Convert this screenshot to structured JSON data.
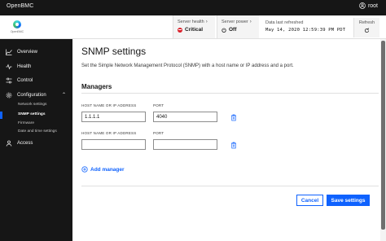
{
  "header": {
    "app_title": "OpenBMC",
    "user": "root",
    "user_icon": "user-avatar-icon"
  },
  "status": {
    "logo_text": "OpenBMC",
    "health_label": "Server health",
    "health_value": "Critical",
    "health_color": "#da1e28",
    "power_label": "Server power",
    "power_value": "Off",
    "refresh_label": "Data last refreshed",
    "refresh_date": "May 14, 2020 12:59:39 PM PDT",
    "refresh_button": "Refresh"
  },
  "sidebar": {
    "items": [
      {
        "label": "Overview",
        "icon": "dashboard-icon"
      },
      {
        "label": "Health",
        "icon": "health-icon"
      },
      {
        "label": "Control",
        "icon": "control-icon"
      },
      {
        "label": "Configuration",
        "icon": "settings-icon"
      },
      {
        "label": "Access",
        "icon": "access-icon"
      }
    ],
    "sub_items": [
      {
        "label": "Network settings"
      },
      {
        "label": "SNMP settings",
        "active": true
      },
      {
        "label": "Firmware"
      },
      {
        "label": "Date and time settings"
      }
    ]
  },
  "main": {
    "title": "SNMP settings",
    "description": "Set the Simple Network Management Protocol (SNMP) with a host name or IP address and a port.",
    "section_title": "Managers",
    "host_label": "HOST NAME OR IP ADDRESS",
    "port_label": "PORT",
    "managers": [
      {
        "host": "1.1.1.1",
        "port": "4040"
      },
      {
        "host": "",
        "port": ""
      }
    ],
    "add_manager_label": "Add manager",
    "cancel_label": "Cancel",
    "save_label": "Save settings"
  },
  "colors": {
    "accent": "#0f62fe",
    "sidebar_bg": "#161616"
  }
}
